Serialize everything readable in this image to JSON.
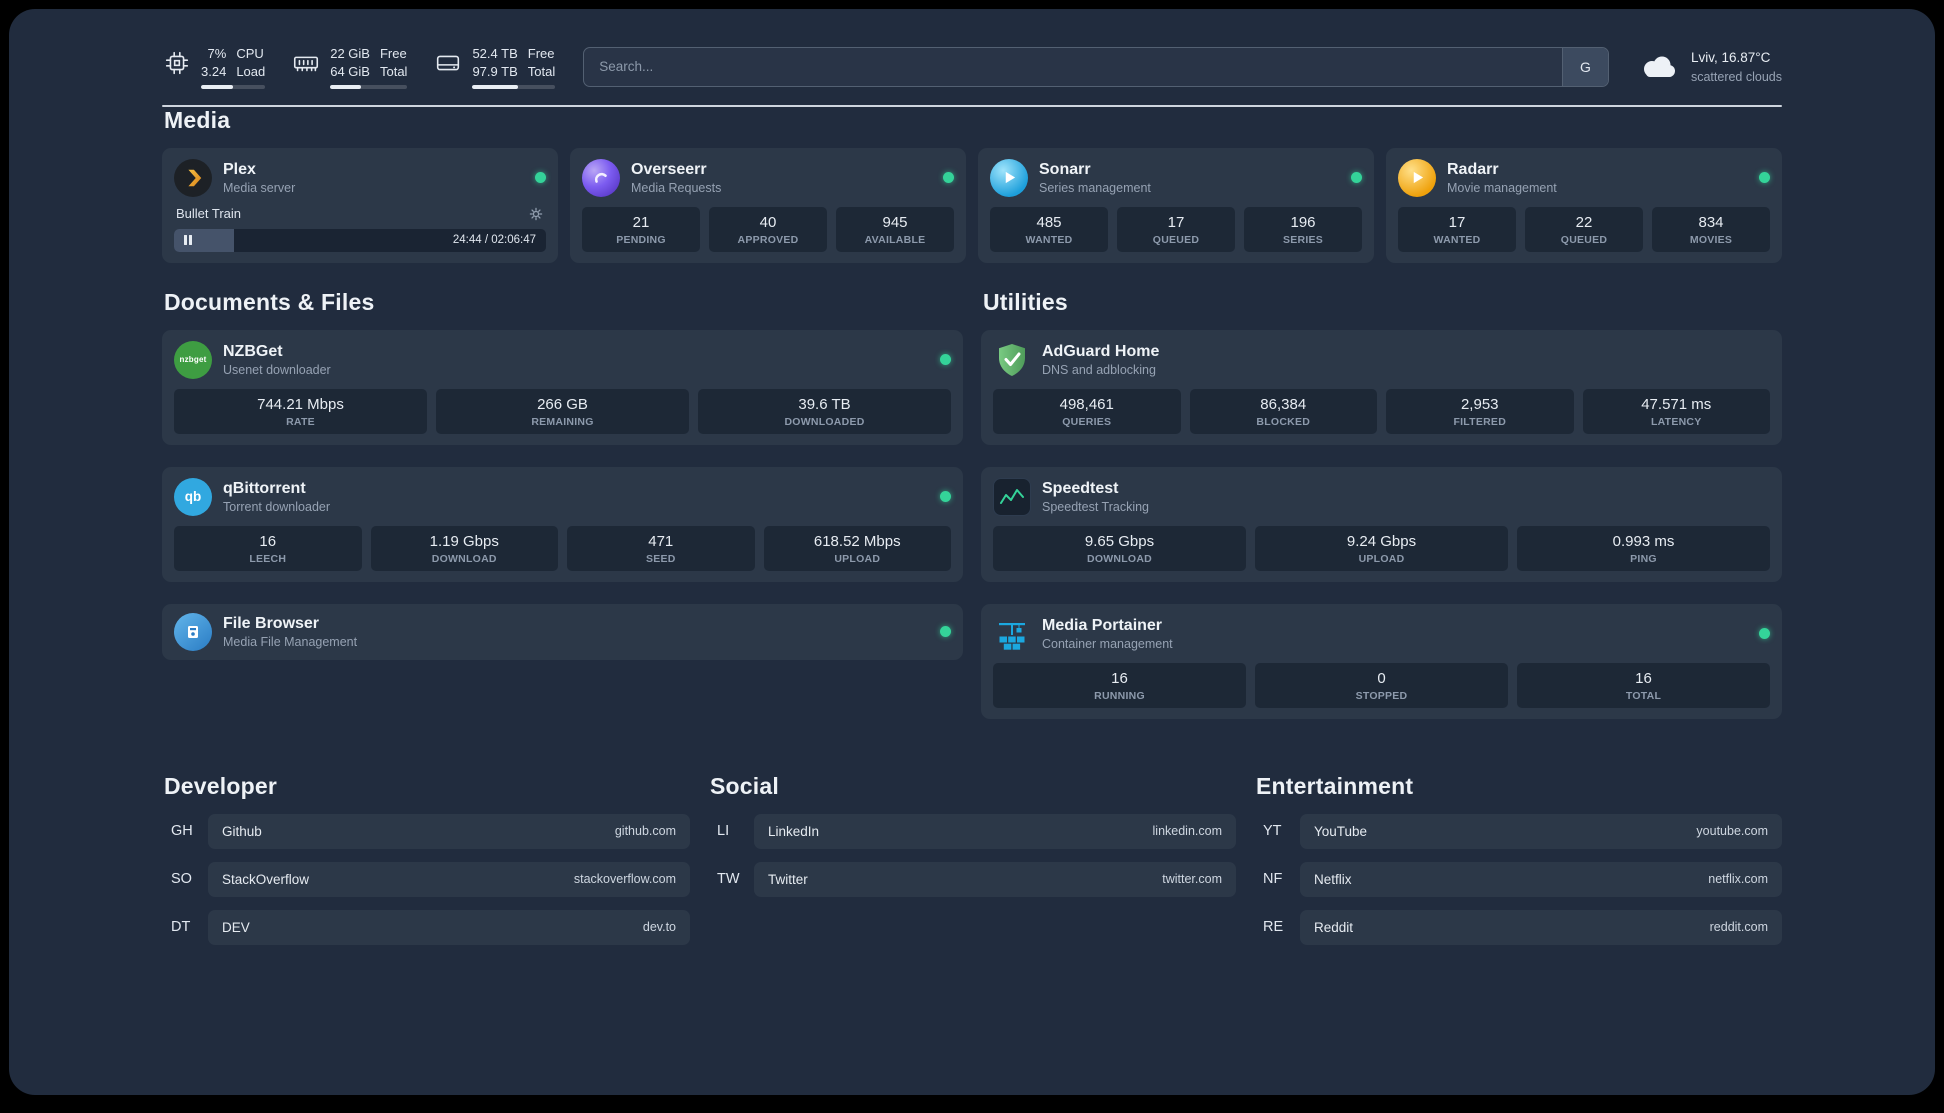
{
  "topbar": {
    "cpu": {
      "values": [
        "7%",
        "3.24"
      ],
      "labels": [
        "CPU",
        "Load"
      ],
      "bar_pct": 50
    },
    "ram": {
      "values": [
        "22 GiB",
        "64 GiB"
      ],
      "labels": [
        "Free",
        "Total"
      ],
      "bar_pct": 40
    },
    "disk": {
      "values": [
        "52.4 TB",
        "97.9 TB"
      ],
      "labels": [
        "Free",
        "Total"
      ],
      "bar_pct": 55
    },
    "search": {
      "placeholder": "Search...",
      "provider_button": "G"
    },
    "weather": {
      "location": "Lviv, 16.87°C",
      "condition": "scattered clouds"
    }
  },
  "sections": {
    "media": "Media",
    "documents": "Documents & Files",
    "utilities": "Utilities",
    "developer": "Developer",
    "social": "Social",
    "entertainment": "Entertainment"
  },
  "services": {
    "plex": {
      "title": "Plex",
      "subtitle": "Media server",
      "status": "online",
      "now_playing": {
        "title": "Bullet Train",
        "time": "24:44 / 02:06:47",
        "progress_pct": 16
      }
    },
    "overseerr": {
      "title": "Overseerr",
      "subtitle": "Media Requests",
      "status": "online",
      "stats": [
        {
          "value": "21",
          "label": "PENDING"
        },
        {
          "value": "40",
          "label": "APPROVED"
        },
        {
          "value": "945",
          "label": "AVAILABLE"
        }
      ]
    },
    "sonarr": {
      "title": "Sonarr",
      "subtitle": "Series management",
      "status": "online",
      "stats": [
        {
          "value": "485",
          "label": "WANTED"
        },
        {
          "value": "17",
          "label": "QUEUED"
        },
        {
          "value": "196",
          "label": "SERIES"
        }
      ]
    },
    "radarr": {
      "title": "Radarr",
      "subtitle": "Movie management",
      "status": "online",
      "stats": [
        {
          "value": "17",
          "label": "WANTED"
        },
        {
          "value": "22",
          "label": "QUEUED"
        },
        {
          "value": "834",
          "label": "MOVIES"
        }
      ]
    },
    "nzbget": {
      "title": "NZBGet",
      "subtitle": "Usenet downloader",
      "status": "online",
      "stats": [
        {
          "value": "744.21 Mbps",
          "label": "RATE"
        },
        {
          "value": "266 GB",
          "label": "REMAINING"
        },
        {
          "value": "39.6 TB",
          "label": "DOWNLOADED"
        }
      ]
    },
    "qbittorrent": {
      "title": "qBittorrent",
      "subtitle": "Torrent downloader",
      "status": "online",
      "stats": [
        {
          "value": "16",
          "label": "LEECH"
        },
        {
          "value": "1.19 Gbps",
          "label": "DOWNLOAD"
        },
        {
          "value": "471",
          "label": "SEED"
        },
        {
          "value": "618.52 Mbps",
          "label": "UPLOAD"
        }
      ]
    },
    "filebrowser": {
      "title": "File Browser",
      "subtitle": "Media File Management",
      "status": "online"
    },
    "adguard": {
      "title": "AdGuard Home",
      "subtitle": "DNS and adblocking",
      "stats": [
        {
          "value": "498,461",
          "label": "QUERIES"
        },
        {
          "value": "86,384",
          "label": "BLOCKED"
        },
        {
          "value": "2,953",
          "label": "FILTERED"
        },
        {
          "value": "47.571 ms",
          "label": "LATENCY"
        }
      ]
    },
    "speedtest": {
      "title": "Speedtest",
      "subtitle": "Speedtest Tracking",
      "stats": [
        {
          "value": "9.65 Gbps",
          "label": "DOWNLOAD"
        },
        {
          "value": "9.24 Gbps",
          "label": "UPLOAD"
        },
        {
          "value": "0.993 ms",
          "label": "PING"
        }
      ]
    },
    "portainer": {
      "title": "Media Portainer",
      "subtitle": "Container management",
      "status": "online",
      "stats": [
        {
          "value": "16",
          "label": "RUNNING"
        },
        {
          "value": "0",
          "label": "STOPPED"
        },
        {
          "value": "16",
          "label": "TOTAL"
        }
      ]
    }
  },
  "bookmarks": {
    "developer": [
      {
        "abbr": "GH",
        "name": "Github",
        "url": "github.com"
      },
      {
        "abbr": "SO",
        "name": "StackOverflow",
        "url": "stackoverflow.com"
      },
      {
        "abbr": "DT",
        "name": "DEV",
        "url": "dev.to"
      }
    ],
    "social": [
      {
        "abbr": "LI",
        "name": "LinkedIn",
        "url": "linkedin.com"
      },
      {
        "abbr": "TW",
        "name": "Twitter",
        "url": "twitter.com"
      }
    ],
    "entertainment": [
      {
        "abbr": "YT",
        "name": "YouTube",
        "url": "youtube.com"
      },
      {
        "abbr": "NF",
        "name": "Netflix",
        "url": "netflix.com"
      },
      {
        "abbr": "RE",
        "name": "Reddit",
        "url": "reddit.com"
      }
    ]
  },
  "colors": {
    "status_online": "#34d399",
    "background": "#212c3e",
    "card": "#2c3848",
    "tile": "#1d2836",
    "plex_gold": "#e5a00d",
    "speedtest_line": "#34d399",
    "portainer_blue": "#1ba8e0"
  }
}
